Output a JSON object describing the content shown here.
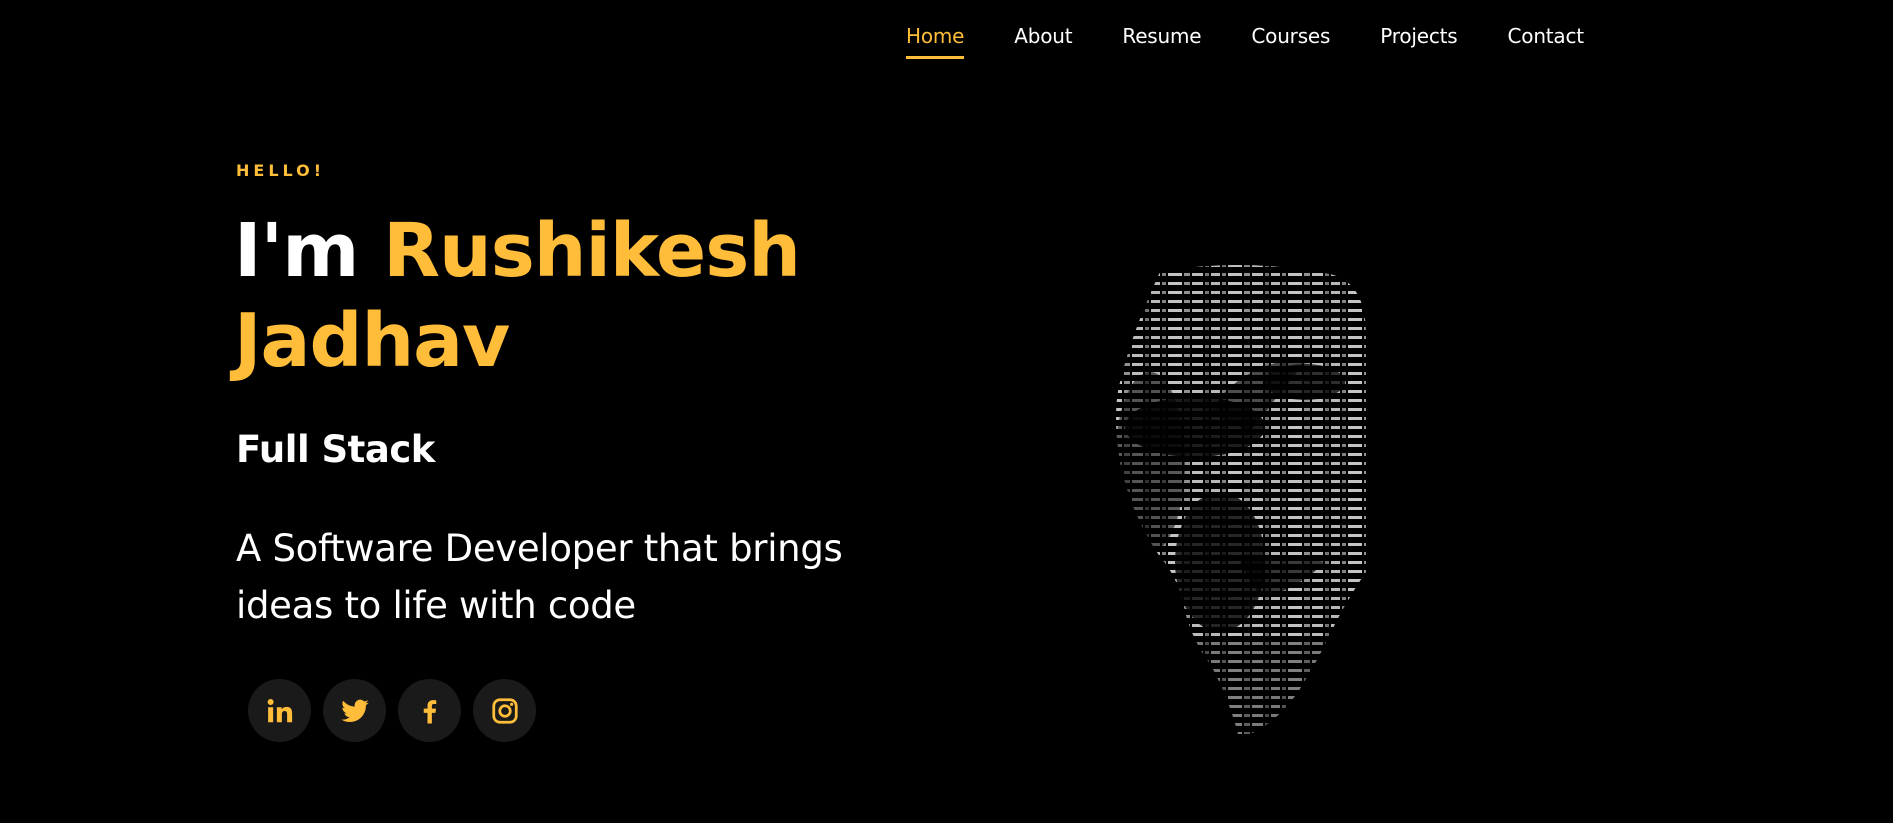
{
  "nav": {
    "items": [
      {
        "label": "Home",
        "active": true
      },
      {
        "label": "About",
        "active": false
      },
      {
        "label": "Resume",
        "active": false
      },
      {
        "label": "Courses",
        "active": false
      },
      {
        "label": "Projects",
        "active": false
      },
      {
        "label": "Contact",
        "active": false
      }
    ]
  },
  "hero": {
    "greeting": "HELLO!",
    "intro": "I'm",
    "name": "Rushikesh Jadhav",
    "role": "Full Stack",
    "tagline": "A Software Developer that brings ideas to life with code"
  },
  "social": [
    {
      "icon": "linkedin-icon"
    },
    {
      "icon": "twitter-icon"
    },
    {
      "icon": "facebook-icon"
    },
    {
      "icon": "instagram-icon"
    }
  ],
  "colors": {
    "background": "#000000",
    "accent": "#ffbd39",
    "text": "#ffffff",
    "social_bg": "#1a1a1a"
  }
}
